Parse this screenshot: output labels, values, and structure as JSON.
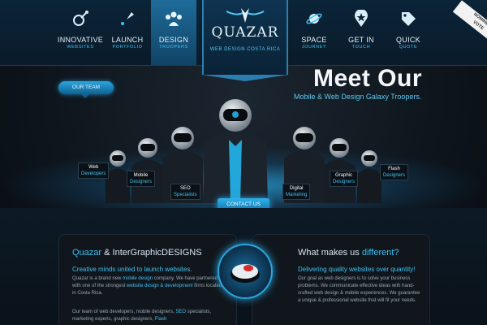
{
  "nav": {
    "left": [
      {
        "t1": "INNOVATIVE",
        "t2": "WEBSITES",
        "icon": "satellite-icon"
      },
      {
        "t1": "LAUNCH",
        "t2": "PORTFOLIO",
        "icon": "rocket-icon"
      },
      {
        "t1": "DESIGN",
        "t2": "TROOPERS",
        "icon": "group-icon"
      }
    ],
    "right": [
      {
        "t1": "SPACE",
        "t2": "JOURNEY",
        "icon": "planet-icon"
      },
      {
        "t1": "GET IN",
        "t2": "TOUCH",
        "icon": "star-pin-icon"
      },
      {
        "t1": "QUICK",
        "t2": "QUOTE",
        "icon": "tag-icon"
      }
    ]
  },
  "logo": {
    "word": "QUAZAR",
    "sub": "WEB DESIGN COSTA RICA"
  },
  "nominee": {
    "l1": "NOMINEE",
    "l2": "VOTE"
  },
  "hero": {
    "our_team": "OUR TEAM",
    "title": "Meet Our",
    "subtitle": "Mobile & Web Design Galaxy Troopers."
  },
  "tags": [
    {
      "a": "Web",
      "b": "Developers"
    },
    {
      "a": "Mobile",
      "b": "Designers"
    },
    {
      "a": "SEO",
      "b": "Specialists"
    },
    {
      "a": "Digital",
      "b": "Marketing"
    },
    {
      "a": "Graphic",
      "b": "Designers"
    },
    {
      "a": "Flash",
      "b": "Designers"
    }
  ],
  "contact": "CONTACT US",
  "left_panel": {
    "title_a": "Quazar",
    "title_b": " & InterGraphicDESIGNS",
    "lead": "Creative minds united to launch websites.",
    "body_1": "Quazar is a brand new ",
    "body_1_link": "mobile design",
    "body_2": " company. We have partnered up with one of the strongest ",
    "body_2_link": "website design & development",
    "body_3": " firms located in Costa Rica.",
    "team_1": "Our team of web developers, mobile designers, ",
    "team_link": "SEO",
    "team_2": " specialists, marketing experts, graphic designers, ",
    "team_link2": "Flash"
  },
  "right_panel": {
    "title_a": "What makes us ",
    "title_b": "different?",
    "lead": "Delivering quality websites over quantity!",
    "body": "Our goal as web designers is to solve your business problems. We communicate effective ideas with hand-crafted web design & mobile experiences. We guarantee a unique & professional website that will fit your needs."
  },
  "colors": {
    "accent": "#3fc1f2",
    "nav_bg": "#0b2438",
    "panel_bg": "#10161c"
  }
}
